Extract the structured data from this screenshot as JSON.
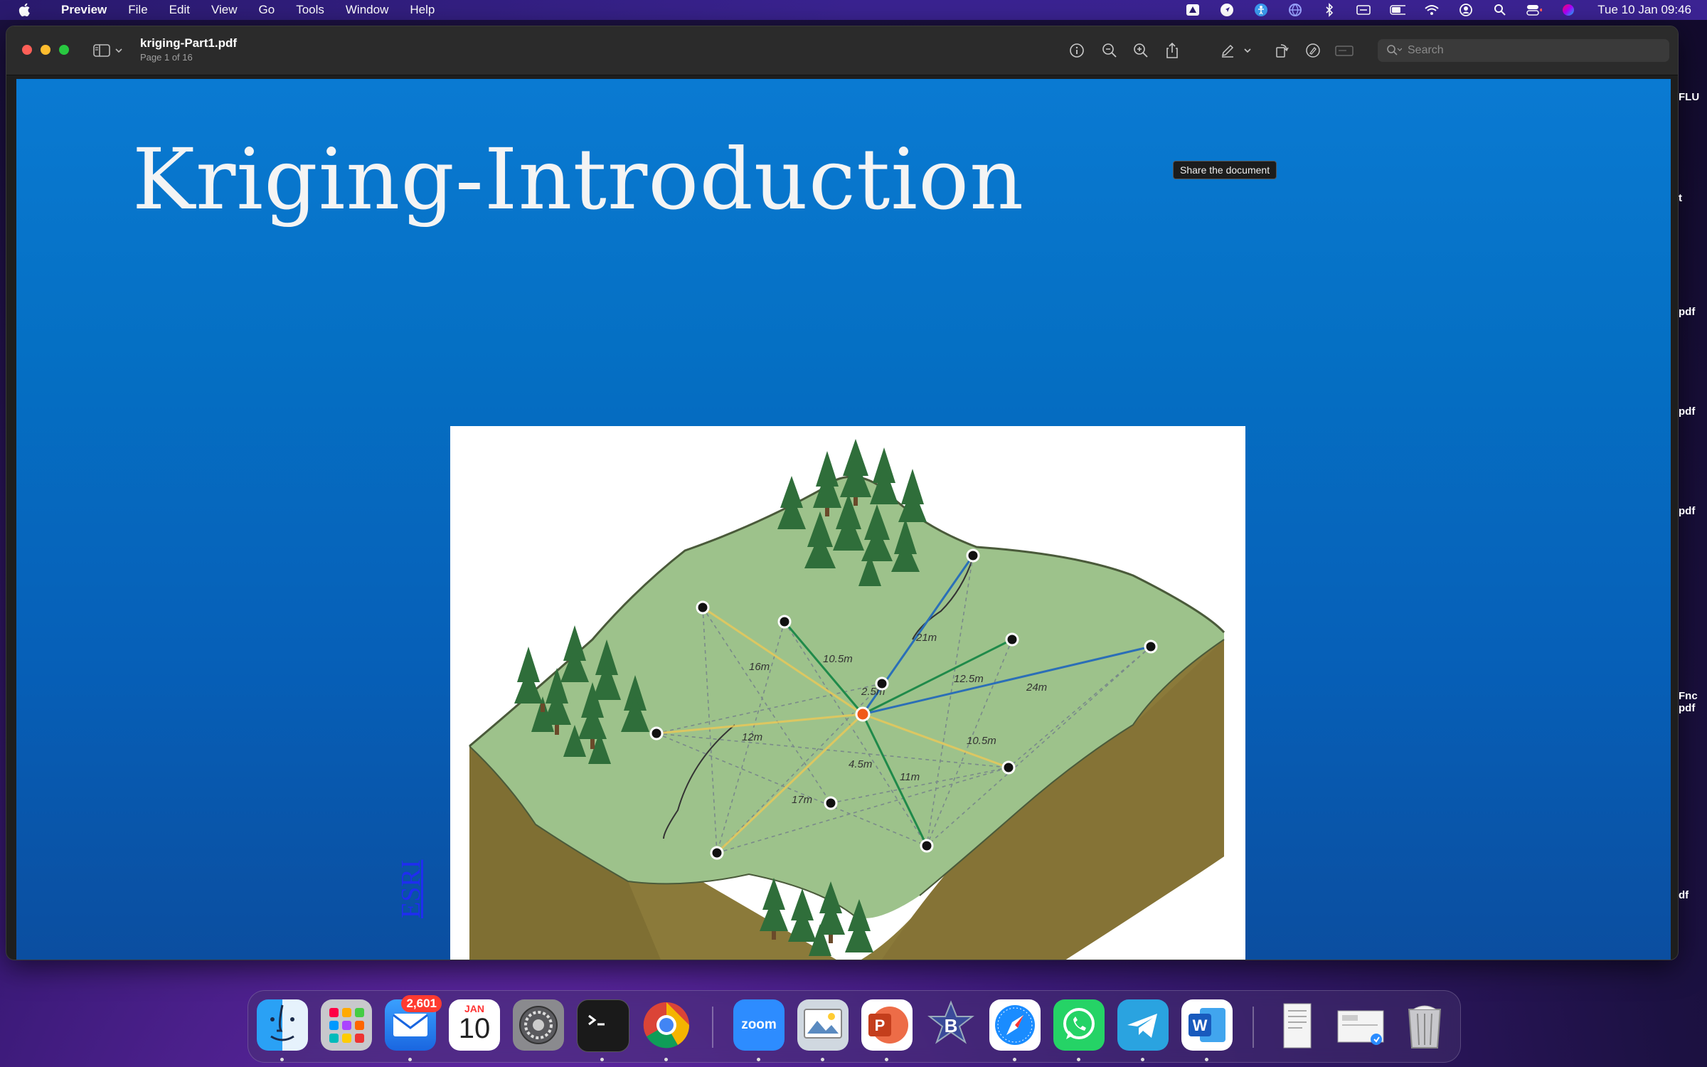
{
  "menubar": {
    "app_name": "Preview",
    "menus": [
      "File",
      "Edit",
      "View",
      "Go",
      "Tools",
      "Window",
      "Help"
    ],
    "clock": "Tue 10 Jan  09:46"
  },
  "window": {
    "doc_title": "kriging-Part1.pdf",
    "page_info": "Page 1 of 16",
    "search_placeholder": "Search"
  },
  "tooltip": "Share the document",
  "slide": {
    "title": "Kriging-Introduction",
    "credit_link": "ESRI",
    "distance_labels": [
      "10.5m",
      "21m",
      "16m",
      "2.5m",
      "12.5m",
      "24m",
      "12m",
      "10.5m",
      "4.5m",
      "11m",
      "17m"
    ]
  },
  "side_files": [
    "FLU",
    "t",
    "pdf",
    "pdf",
    "pdf",
    "Fnc pdf",
    "df"
  ],
  "dock": {
    "mail_badge": "2,601",
    "calendar_month": "JAN",
    "calendar_day": "10",
    "zoom_label": "zoom",
    "apps": [
      "Finder",
      "Launchpad",
      "Mail",
      "Calendar",
      "System Settings",
      "Terminal",
      "Chrome",
      "Zoom",
      "Preview",
      "PowerPoint",
      "BBEdit",
      "Safari",
      "WhatsApp",
      "Telegram",
      "Word",
      "Documents",
      "Downloads",
      "Trash"
    ]
  },
  "colors": {
    "slide_blue": "#0670c6",
    "title_text": "#f4f4f4",
    "link_blue": "#1f2df0"
  }
}
